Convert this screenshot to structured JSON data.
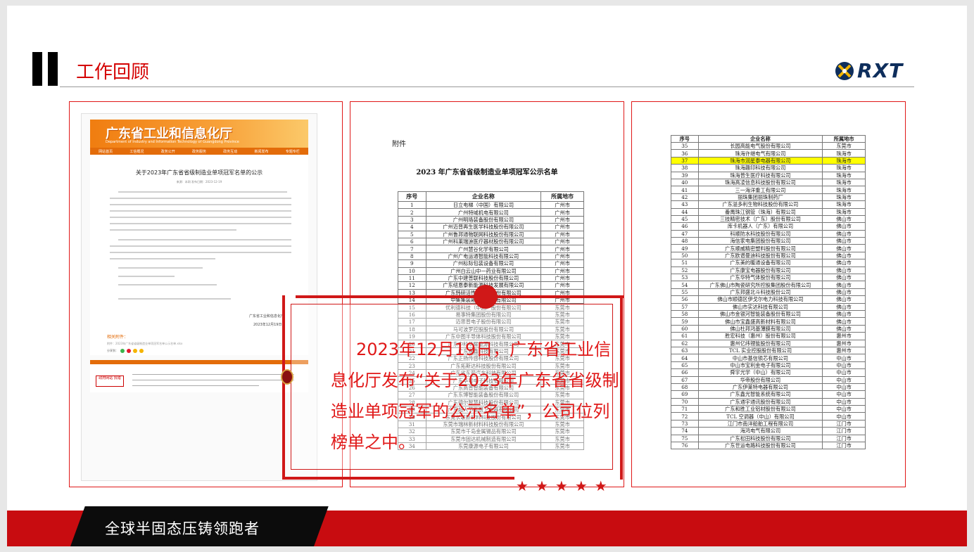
{
  "header": {
    "title": "工作回顾",
    "logo_text": "RXT"
  },
  "left_panel": {
    "site_title": "广东省工业和信息化厅",
    "site_subtitle": "Department of Industry and Information Technology of Guangdong Province",
    "nav_items": [
      "网站首页",
      "工信概况",
      "政务公开",
      "政务服务",
      "政务互动",
      "新闻发布",
      "专题专栏"
    ],
    "article_title": "关于2023年广东省省级制造业单项冠军名单的公示",
    "article_meta": "来源：本网 发布日期：2023-12-19",
    "attachment_label": "相关附件：",
    "attachment_link": "附件：2023年广东省省级制造业单项冠军名单公示名单.xlsx",
    "share_label": "分享到：",
    "sign_org": "广东省工业和信息化厅",
    "sign_date": "2023年12月19日",
    "footer_logo": "政府网站 找错"
  },
  "middle_panel": {
    "attachment": "附件",
    "title": "2023 年广东省省级制造业单项冠军公示名单",
    "columns": [
      "序号",
      "企业名称",
      "所属地市"
    ],
    "rows": [
      [
        "1",
        "日立电梯（中国）有限公司",
        "广州市"
      ],
      [
        "2",
        "广州特域机电有限公司",
        "广州市"
      ],
      [
        "3",
        "广州明珞装备股份有限公司",
        "广州市"
      ],
      [
        "4",
        "广州迈普再生医学科技股份有限公司",
        "广州市"
      ],
      [
        "5",
        "广州鲁邦通物联网科技股份有限公司",
        "广州市"
      ],
      [
        "6",
        "广州科莱瑞迪医疗器材股份有限公司",
        "广州市"
      ],
      [
        "7",
        "广州慧谷化学有限公司",
        "广州市"
      ],
      [
        "8",
        "广州广电运通智能科技有限公司",
        "广州市"
      ],
      [
        "9",
        "广州标际包装设备有限公司",
        "广州市"
      ],
      [
        "10",
        "广州白云山中一药业有限公司",
        "广州市"
      ],
      [
        "11",
        "广东中建普联科技股份有限公司",
        "广州市"
      ],
      [
        "12",
        "广东纽恩泰新能源科技发展有限公司",
        "广州市"
      ],
      [
        "13",
        "广东韩研活性炭科技股份有限公司",
        "广州市"
      ],
      [
        "14",
        "中集集装箱（广州）有限公司",
        "广州市"
      ],
      [
        "15",
        "优利德科技（中国）股份有限公司",
        "东莞市"
      ],
      [
        "16",
        "易事特集团股份有限公司",
        "东莞市"
      ],
      [
        "17",
        "迈思普电子股份有限公司",
        "东莞市"
      ],
      [
        "18",
        "马可波罗控股股份有限公司",
        "东莞市"
      ],
      [
        "19",
        "广东中图半导体科技股份有限公司",
        "东莞市"
      ],
      [
        "20",
        "广东中科华曜能源科技有限公司",
        "东莞市"
      ],
      [
        "21",
        "广东永鑫科技有限公司",
        "东莞市"
      ],
      [
        "22",
        "广东正扬传感科技股份有限公司",
        "东莞市"
      ],
      [
        "23",
        "广东拓斯达科技股份有限公司",
        "东莞市"
      ],
      [
        "24",
        "广东省东箭汽车科技有限公司",
        "东莞市"
      ],
      [
        "25",
        "广东华粤电子科技有限公司",
        "东莞市"
      ],
      [
        "26",
        "广东高普智能装备有限公司",
        "东莞市"
      ],
      [
        "27",
        "广东东博智能装备股份有限公司",
        "东莞市"
      ],
      [
        "28",
        "广东德尔智慧科技股份有限公司",
        "东莞市"
      ],
      [
        "29",
        "广东超人节能厨卫电器有限公司",
        "东莞市"
      ],
      [
        "30",
        "东莞长联新材料科技股份有限公司",
        "东莞市"
      ],
      [
        "31",
        "东莞市瑞林新材料科技股份有限公司",
        "东莞市"
      ],
      [
        "32",
        "东莞市千岛金属锡品有限公司",
        "东莞市"
      ],
      [
        "33",
        "东莞市固达机械制造有限公司",
        "东莞市"
      ],
      [
        "34",
        "东莞康源电子有限公司",
        "东莞市"
      ]
    ]
  },
  "right_panel": {
    "columns": [
      "序号",
      "企业名称",
      "所属地市"
    ],
    "highlight_index": 2,
    "rows": [
      [
        "35",
        "长园高能电气股份有限公司",
        "东莞市"
      ],
      [
        "36",
        "珠海许继电气有限公司",
        "珠海市"
      ],
      [
        "37",
        "珠海市润星泰电器有限公司",
        "珠海市"
      ],
      [
        "38",
        "珠海趣印科技有限公司",
        "珠海市"
      ],
      [
        "39",
        "珠海普生医疗科技有限公司",
        "珠海市"
      ],
      [
        "40",
        "珠海高凌信息科技股份有限公司",
        "珠海市"
      ],
      [
        "41",
        "三一海洋重工有限公司",
        "珠海市"
      ],
      [
        "42",
        "丽珠集团丽珠制药厂",
        "珠海市"
      ],
      [
        "43",
        "广东溢多利生物科技股份有限公司",
        "珠海市"
      ],
      [
        "44",
        "番禺珠江钢管（珠海）有限公司",
        "珠海市"
      ],
      [
        "45",
        "三技精密技术（广东）股份有限公司",
        "佛山市"
      ],
      [
        "46",
        "库卡机器人（广东）有限公司",
        "佛山市"
      ],
      [
        "47",
        "科顺防水科技股份有限公司",
        "佛山市"
      ],
      [
        "48",
        "海信家电集团股份有限公司",
        "佛山市"
      ],
      [
        "49",
        "广东顺威精密塑料股份有限公司",
        "佛山市"
      ],
      [
        "50",
        "广东欧谱曼迪科技股份有限公司",
        "佛山市"
      ],
      [
        "51",
        "广东美的暖通设备有限公司",
        "佛山市"
      ],
      [
        "52",
        "广东康宝电器股份有限公司",
        "佛山市"
      ],
      [
        "53",
        "广东华特气体股份有限公司",
        "佛山市"
      ],
      [
        "54",
        "广东佛山市陶瓷研究所控股集团股份有限公司",
        "佛山市"
      ],
      [
        "55",
        "广东邦盛北斗科技股份公司",
        "佛山市"
      ],
      [
        "56",
        "佛山市顺德区伊戈尔电力科技有限公司",
        "佛山市"
      ],
      [
        "57",
        "佛山市实达科技有限公司",
        "佛山市"
      ],
      [
        "58",
        "佛山市金银河智能装备股份有限公司",
        "佛山市"
      ],
      [
        "59",
        "佛山市宝鑫盛高新材料有限公司",
        "佛山市"
      ],
      [
        "60",
        "佛山杜邦鸿基薄膜有限公司",
        "佛山市"
      ],
      [
        "61",
        "胜宏科技（惠州）股份有限公司",
        "惠州市"
      ],
      [
        "62",
        "惠州亿纬锂能股份有限公司",
        "惠州市"
      ],
      [
        "63",
        "TCL 实业控股股份有限公司",
        "惠州市"
      ],
      [
        "64",
        "中山市基信锁芯有限公司",
        "中山市"
      ],
      [
        "65",
        "中山市宝利金电子有限公司",
        "中山市"
      ],
      [
        "66",
        "舜宇光学（中山）有限公司",
        "中山市"
      ],
      [
        "67",
        "华帝股份有限公司",
        "中山市"
      ],
      [
        "68",
        "广东伊莱特电器有限公司",
        "中山市"
      ],
      [
        "69",
        "广东鑫光智能系统有限公司",
        "中山市"
      ],
      [
        "70",
        "广东通宇通讯股份有限公司",
        "中山市"
      ],
      [
        "71",
        "广东和胜工业铝材股份有限公司",
        "中山市"
      ],
      [
        "72",
        "TCL 空调器（中山）有限公司",
        "中山市"
      ],
      [
        "73",
        "江门市南洋船舶工程有限公司",
        "江门市"
      ],
      [
        "74",
        "海鸿电气有限公司",
        "江门市"
      ],
      [
        "75",
        "广东松田科技股份有限公司",
        "江门市"
      ],
      [
        "76",
        "广东世运电路科技股份有限公司",
        "江门市"
      ]
    ]
  },
  "overlay": {
    "text": "2023年12月19日，广东省工业信息化厅发布“关于2023年广东省省级制造业单项冠军的公示名单”，公司位列榜单之中。"
  },
  "footer": {
    "slogan": "全球半固态压铸领跑者"
  },
  "colors": {
    "accent_red": "#d01818",
    "footer_red": "#c80c10",
    "highlight_yellow": "#ffff00",
    "banner_orange": "#f07d10"
  }
}
